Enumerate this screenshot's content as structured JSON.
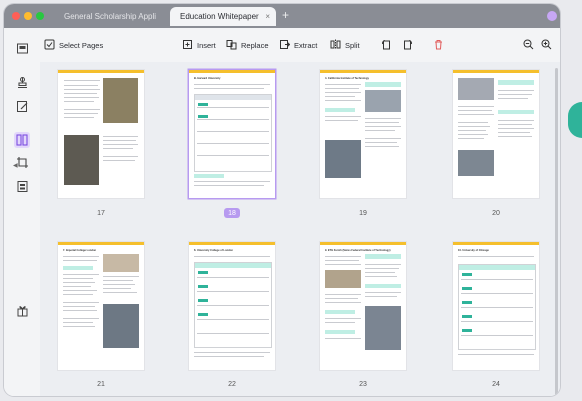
{
  "tabs": [
    {
      "label": "General Scholarship Appli"
    },
    {
      "label": "Education Whitepaper",
      "close": "×"
    }
  ],
  "new_tab": "+",
  "toolbar": {
    "select_pages": "Select Pages",
    "insert": "Insert",
    "replace": "Replace",
    "extract": "Extract",
    "split": "Split"
  },
  "pages": [
    {
      "number": "17"
    },
    {
      "number": "18",
      "selected": true,
      "heading": "B. Harvard University"
    },
    {
      "number": "19",
      "heading": "4. California Institute of Technology"
    },
    {
      "number": "20"
    },
    {
      "number": "21",
      "heading": "7. Imperial College London"
    },
    {
      "number": "22",
      "heading": "8. University College of London"
    },
    {
      "number": "23",
      "heading": "9. ETH Zurich (Swiss Federal Institute of Technology)"
    },
    {
      "number": "24",
      "heading": "10. University of Chicago"
    }
  ],
  "colors": {
    "accent": "#b79af0",
    "page_header": "#f5bf2c",
    "table_head": "#bfeee4"
  }
}
